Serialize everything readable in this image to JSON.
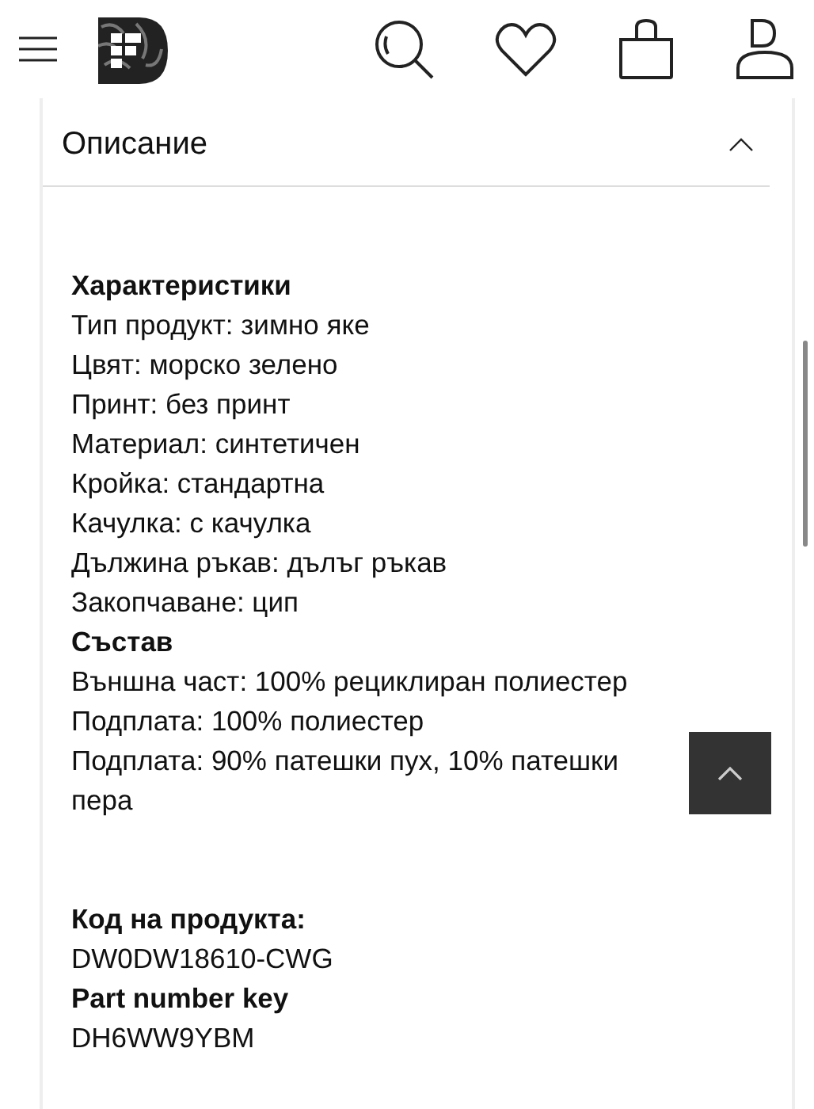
{
  "description_panel": {
    "title": "Описание",
    "expanded": true,
    "groups": [
      [
        {
          "heading": "Характеристики",
          "lines": [
            "Тип продукт: зимно яке",
            "Цвят: морско зелено",
            "Принт: без принт",
            "Материал: синтетичен",
            "Кройка: стандартна",
            "Качулка: с качулка",
            "Дължина ръкав: дълъг ръкав",
            "Закопчаване: цип"
          ]
        },
        {
          "heading": "Състав",
          "lines": [
            "Външна част: 100% рециклиран полиестер",
            "Подплата: 100% полиестер",
            "Подплата: 90% патешки пух, 10% патешки пера"
          ]
        }
      ],
      [
        {
          "heading": "Код на продукта:",
          "lines": [
            "DW0DW18610-CWG"
          ]
        },
        {
          "heading": "Part number key",
          "lines": [
            "DH6WW9YBM"
          ]
        }
      ]
    ]
  }
}
